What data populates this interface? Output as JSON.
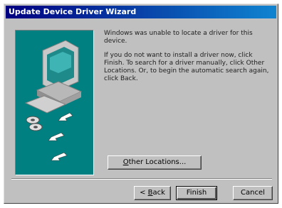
{
  "window": {
    "title": "Update Device Driver Wizard"
  },
  "message": {
    "line1": "Windows was unable to locate a driver for this device.",
    "line2": "If you do not want to install a driver now, click Finish. To search for a driver manually, click Other Locations. Or, to begin the automatic search again, click Back."
  },
  "buttons": {
    "other_locations_prefix": "O",
    "other_locations_rest": "ther Locations...",
    "back_prefix": "< ",
    "back_u": "B",
    "back_rest": "ack",
    "finish": "Finish",
    "cancel": "Cancel"
  },
  "colors": {
    "titlebar": "#000080",
    "art_background": "#008080",
    "window_face": "#c0c0c0"
  },
  "icons": [
    "computer-icon",
    "disk-icon",
    "arrow-icon"
  ]
}
